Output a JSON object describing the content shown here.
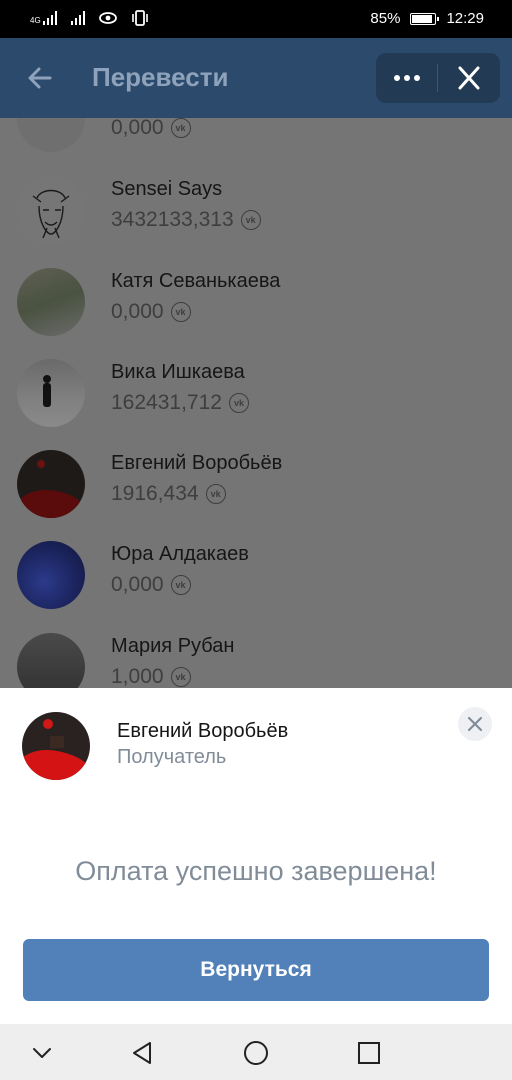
{
  "status_bar": {
    "network_label": "4G",
    "battery": "85%",
    "time": "12:29"
  },
  "app_bar": {
    "title": "Перевести"
  },
  "friends": [
    {
      "name": "",
      "amount": "0,000",
      "currency_icon": "vk-icon"
    },
    {
      "name": "Sensei Says",
      "amount": "3432133,313",
      "currency_icon": "vk-icon"
    },
    {
      "name": "Катя Севанькаева",
      "amount": "0,000",
      "currency_icon": "vk-icon"
    },
    {
      "name": "Вика Ишкаева",
      "amount": "162431,712",
      "currency_icon": "vk-icon"
    },
    {
      "name": "Евгений Воробьёв",
      "amount": "1916,434",
      "currency_icon": "vk-icon"
    },
    {
      "name": "Юра Алдакаев",
      "amount": "0,000",
      "currency_icon": "vk-icon"
    },
    {
      "name": "Мария Рубан",
      "amount": "1,000",
      "currency_icon": "vk-icon"
    }
  ],
  "sheet": {
    "recipient_name": "Евгений Воробьёв",
    "recipient_role": "Получатель",
    "message": "Оплата успешно завершена!",
    "button_label": "Вернуться"
  },
  "colors": {
    "header": "#2c4a6b",
    "accent_button": "#5181b8",
    "overlay": "#757575"
  }
}
